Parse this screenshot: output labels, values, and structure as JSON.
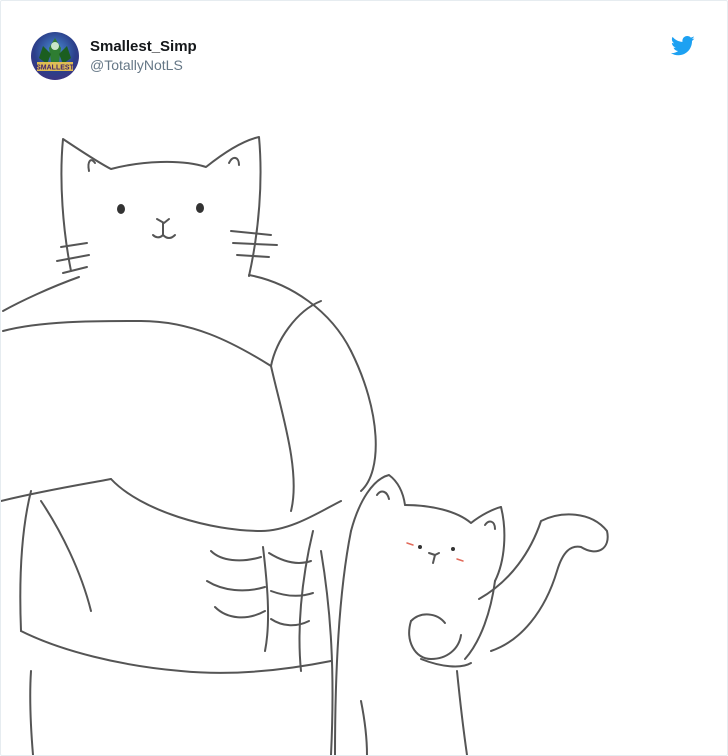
{
  "tweet": {
    "author": {
      "display_name": "Smallest_Simp",
      "handle": "@TotallyNotLS",
      "avatar_text": "SMALLEST"
    },
    "platform_icon": "twitter-bird-icon",
    "brand_color": "#1da1f2",
    "media": {
      "kind": "line drawing",
      "subjects": [
        "muscular-cat",
        "small-cat"
      ]
    }
  }
}
